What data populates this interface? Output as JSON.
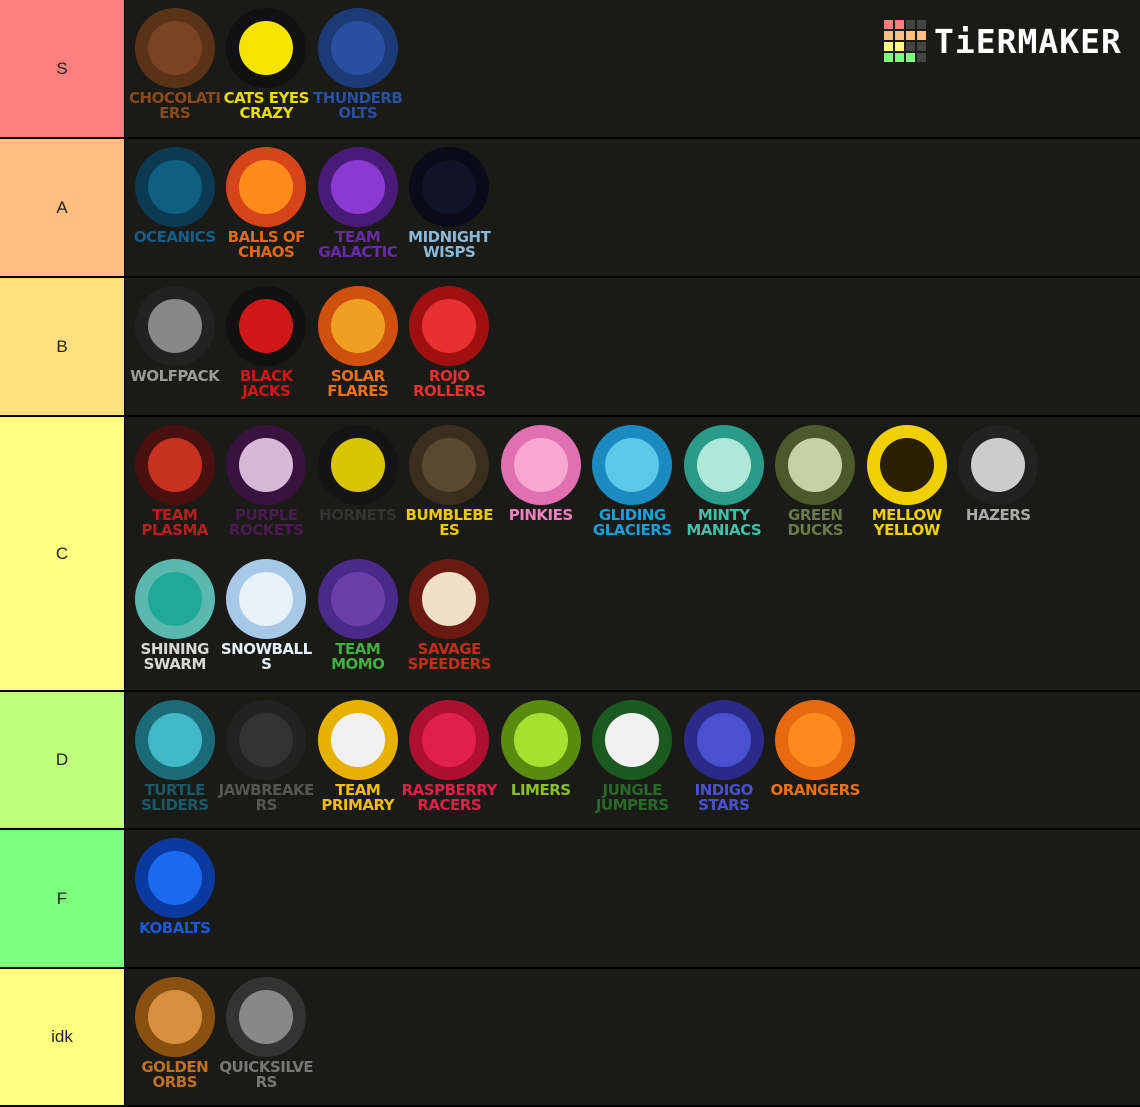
{
  "brand": {
    "name": "TiERMAKER",
    "grid_colors": [
      "#ff7f7f",
      "#ff7f7f",
      "#444",
      "#444",
      "#ffbf7f",
      "#ffbf7f",
      "#ffbf7f",
      "#ffbf7f",
      "#ffff7f",
      "#ffff7f",
      "#444",
      "#444",
      "#7fff7f",
      "#7fff7f",
      "#7fff7f",
      "#444"
    ]
  },
  "tiers": [
    {
      "label": "S",
      "color": "#ff7f7f",
      "items": [
        {
          "name": "Chocolatiers",
          "ring": "#5a3218",
          "fill": "#7a4424",
          "text": "#8b4a1c"
        },
        {
          "name": "Cats Eyes Crazy",
          "ring": "#111",
          "fill": "#f5e400",
          "text": "#e8dc00"
        },
        {
          "name": "Thunderbolts",
          "ring": "#1c3a78",
          "fill": "#2b4fa0",
          "text": "#2b4fa0"
        }
      ]
    },
    {
      "label": "A",
      "color": "#ffbf7f",
      "items": [
        {
          "name": "Oceanics",
          "ring": "#0b3a52",
          "fill": "#0f5f82",
          "text": "#155e8a"
        },
        {
          "name": "Balls of Chaos",
          "ring": "#d8441a",
          "fill": "#ff8c1a",
          "text": "#e06a1a"
        },
        {
          "name": "Team Galactic",
          "ring": "#4a1a78",
          "fill": "#8a3ad0",
          "text": "#6a2aa8"
        },
        {
          "name": "Midnight Wisps",
          "ring": "#0a0a18",
          "fill": "#101428",
          "text": "#8ab8d8"
        }
      ]
    },
    {
      "label": "B",
      "color": "#ffdf7f",
      "items": [
        {
          "name": "Wolfpack",
          "ring": "#222",
          "fill": "#888",
          "text": "#9a9a9a"
        },
        {
          "name": "Black Jacks",
          "ring": "#111",
          "fill": "#d01818",
          "text": "#d01818"
        },
        {
          "name": "Solar Flares",
          "ring": "#d05010",
          "fill": "#f0a020",
          "text": "#f07018"
        },
        {
          "name": "Rojo Rollers",
          "ring": "#a01010",
          "fill": "#e83030",
          "text": "#e83030"
        }
      ]
    },
    {
      "label": "C",
      "color": "#ffff7f",
      "items": [
        {
          "name": "Team Plasma",
          "ring": "#4a1010",
          "fill": "#c83020",
          "text": "#b82020"
        },
        {
          "name": "Purple Rockets",
          "ring": "#3a1240",
          "fill": "#d8b8d8",
          "text": "#4a1a50"
        },
        {
          "name": "Hornets",
          "ring": "#141414",
          "fill": "#d8c400",
          "text": "#333"
        },
        {
          "name": "Bumblebees",
          "ring": "#3a2e1e",
          "fill": "#5a4830",
          "text": "#f0c800"
        },
        {
          "name": "Pinkies",
          "ring": "#e070b0",
          "fill": "#f8a8d0",
          "text": "#f080c0"
        },
        {
          "name": "Gliding Glaciers",
          "ring": "#1a8ac0",
          "fill": "#5ac8e8",
          "text": "#1aa0d8"
        },
        {
          "name": "Minty Maniacs",
          "ring": "#2a9a8a",
          "fill": "#b0e8d8",
          "text": "#40c0a8"
        },
        {
          "name": "Green Ducks",
          "ring": "#4a5a2a",
          "fill": "#c8d0a8",
          "text": "#6a7a4a"
        },
        {
          "name": "Mellow Yellow",
          "ring": "#f0d000",
          "fill": "#2a2000",
          "text": "#f0d000"
        },
        {
          "name": "Hazers",
          "ring": "#222",
          "fill": "#ccc",
          "text": "#aaa"
        },
        {
          "name": "Shining Swarm",
          "ring": "#5ab8b0",
          "fill": "#20a898",
          "text": "#d8d8d8"
        },
        {
          "name": "Snowballs",
          "ring": "#a8c8e8",
          "fill": "#e8f0f8",
          "text": "#e8f0f8"
        },
        {
          "name": "Team Momo",
          "ring": "#4a2a88",
          "fill": "#6a40a8",
          "text": "#40b040"
        },
        {
          "name": "Savage Speeders",
          "ring": "#6a1a10",
          "fill": "#f0e0c8",
          "text": "#c03018"
        }
      ]
    },
    {
      "label": "D",
      "color": "#bfff7f",
      "items": [
        {
          "name": "Turtle Sliders",
          "ring": "#1a6a78",
          "fill": "#40b8c8",
          "text": "#1a5a68"
        },
        {
          "name": "Jawbreakers",
          "ring": "#222",
          "fill": "#333",
          "text": "#555"
        },
        {
          "name": "Team Primary",
          "ring": "#e8b000",
          "fill": "#f0f0f0",
          "text": "#f0c000"
        },
        {
          "name": "Raspberry Racers",
          "ring": "#b01030",
          "fill": "#e02048",
          "text": "#e02048"
        },
        {
          "name": "Limers",
          "ring": "#5a8a10",
          "fill": "#a8e030",
          "text": "#8ac020"
        },
        {
          "name": "Jungle Jumpers",
          "ring": "#1a5a20",
          "fill": "#f0f0f0",
          "text": "#2a6a28"
        },
        {
          "name": "Indigo Stars",
          "ring": "#2a2a88",
          "fill": "#4a50d0",
          "text": "#4a50d0"
        },
        {
          "name": "Orangers",
          "ring": "#e86a10",
          "fill": "#ff8a20",
          "text": "#f07010"
        }
      ]
    },
    {
      "label": "F",
      "color": "#7fff7f",
      "items": [
        {
          "name": "Kobalts",
          "ring": "#0a3aa0",
          "fill": "#1a6af0",
          "text": "#1a5ad8"
        }
      ]
    },
    {
      "label": "idk",
      "color": "#ffff7f",
      "items": [
        {
          "name": "Golden Orbs",
          "ring": "#8a5010",
          "fill": "#d89040",
          "text": "#c07020"
        },
        {
          "name": "Quicksilvers",
          "ring": "#333",
          "fill": "#888",
          "text": "#777"
        }
      ]
    }
  ]
}
